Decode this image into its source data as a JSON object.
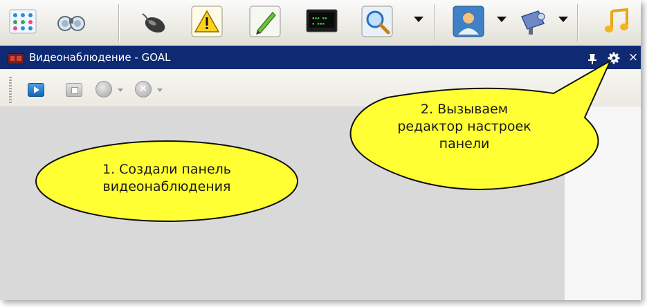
{
  "toolbar": {
    "buttons": [
      {
        "name": "grid-icon"
      },
      {
        "name": "binoculars-icon"
      },
      {
        "name": "mouse-icon"
      },
      {
        "name": "warning-icon"
      },
      {
        "name": "pen-icon"
      },
      {
        "name": "monitor-icon"
      },
      {
        "name": "search-icon"
      },
      {
        "name": "user-icon"
      },
      {
        "name": "camera-icon"
      },
      {
        "name": "music-icon"
      }
    ]
  },
  "panel": {
    "title": "Видеонаблюдение - GOAL",
    "close_glyph": "×"
  },
  "subtoolbar": {
    "cancel_glyph": "×"
  },
  "callouts": {
    "create_panel": [
      "1. Создали панель",
      "видеонаблюдения"
    ],
    "open_editor": [
      "2. Вызываем",
      "редактор настроек",
      "панели"
    ]
  },
  "colors": {
    "titlebar_bg": "#0d2a73",
    "content_bg": "#d9d9d9",
    "callout_fill": "#ffff33",
    "toolbar_bg": "#ecebe4"
  }
}
